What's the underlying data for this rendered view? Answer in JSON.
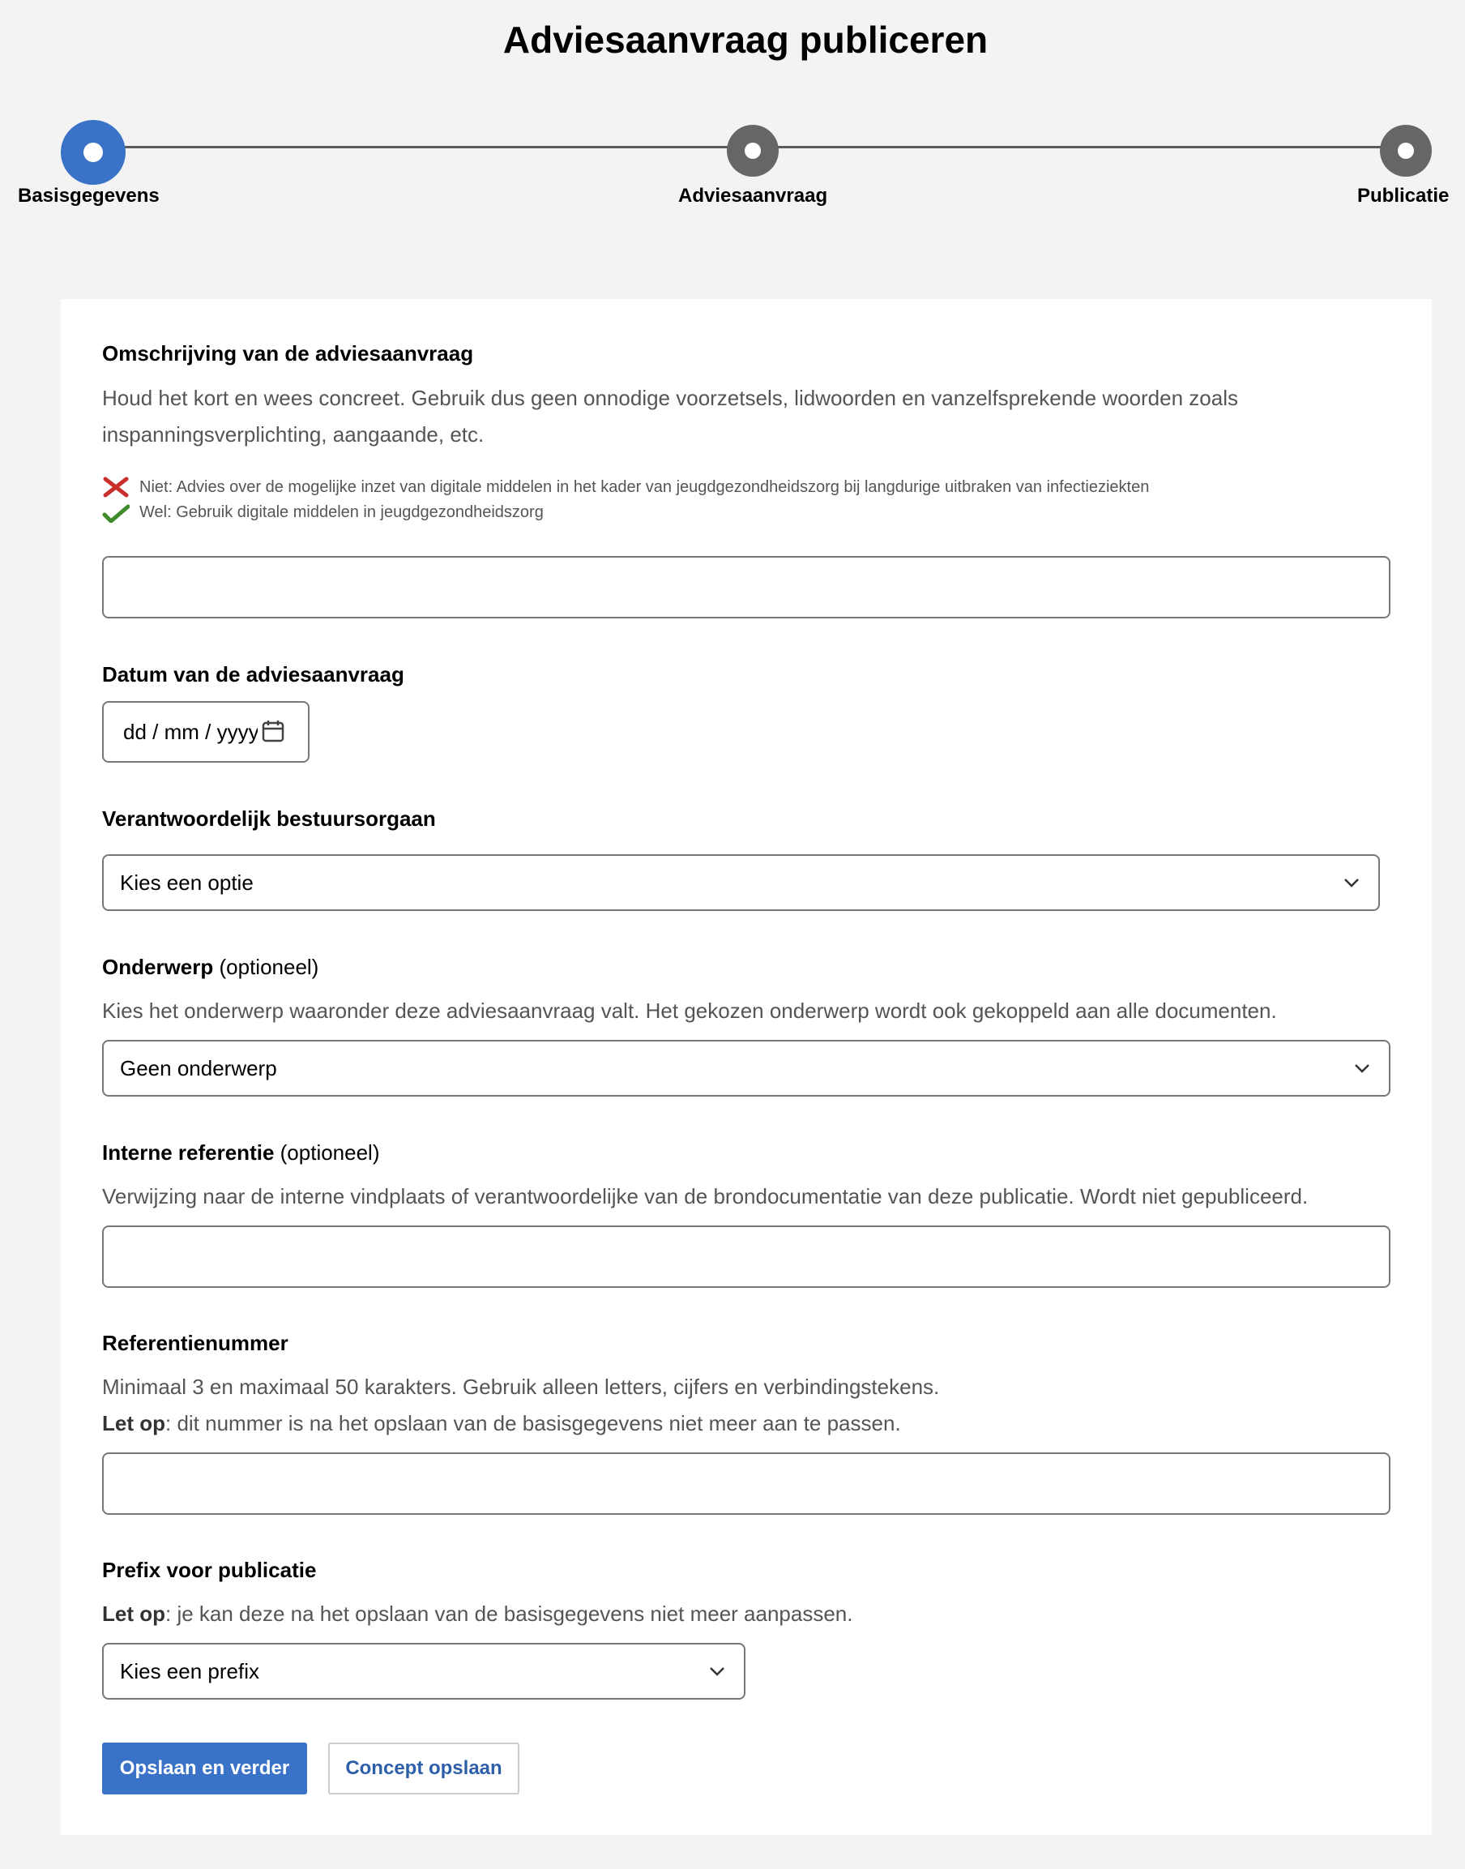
{
  "page": {
    "title": "Adviesaanvraag publiceren"
  },
  "stepper": {
    "steps": [
      {
        "label": "Basisgegevens",
        "active": true
      },
      {
        "label": "Adviesaanvraag",
        "active": false
      },
      {
        "label": "Publicatie",
        "active": false
      }
    ],
    "colors": {
      "active": "#3a72c7",
      "inactive": "#666666"
    }
  },
  "form": {
    "omschrijving": {
      "label": "Omschrijving van de adviesaanvraag",
      "help_line1": "Houd het kort en wees concreet. Gebruik dus geen onnodige voorzetsels, lidwoorden en vanzelfsprekende woorden zoals",
      "help_line2": "inspanningsverplichting, aangaande, etc.",
      "example_bad": "Niet: Advies over de mogelijke inzet van digitale middelen in het kader van jeugdgezondheidszorg bij langdurige uitbraken van infectieziekten",
      "example_good": "Wel: Gebruik digitale middelen in jeugdgezondheidszorg",
      "value": ""
    },
    "datum": {
      "label": "Datum van de adviesaanvraag",
      "placeholder": "dd / mm / yyyy"
    },
    "bestuursorgaan": {
      "label": "Verantwoordelijk bestuursorgaan",
      "selected": "Kies een optie"
    },
    "onderwerp": {
      "label": "Onderwerp",
      "optional": "(optioneel)",
      "help": "Kies het onderwerp waaronder deze adviesaanvraag valt. Het gekozen onderwerp wordt ook gekoppeld aan alle documenten.",
      "selected": "Geen onderwerp"
    },
    "interne_referentie": {
      "label": "Interne referentie",
      "optional": "(optioneel)",
      "help": "Verwijzing naar de interne vindplaats of verantwoordelijke van de brondocumentatie van deze publicatie. Wordt niet gepubliceerd.",
      "value": ""
    },
    "referentienummer": {
      "label": "Referentienummer",
      "help": "Minimaal 3 en maximaal 50 karakters. Gebruik alleen letters, cijfers en verbindingstekens.",
      "note_strong": "Let op",
      "note_rest": ": dit nummer is na het opslaan van de basisgegevens niet meer aan te passen.",
      "value": ""
    },
    "prefix": {
      "label": "Prefix voor publicatie",
      "note_strong": "Let op",
      "note_rest": ": je kan deze na het opslaan van de basisgegevens niet meer aanpassen.",
      "selected": "Kies een prefix"
    }
  },
  "actions": {
    "primary_label": "Opslaan en verder",
    "secondary_label": "Concept opslaan"
  },
  "icons": {
    "bad": "red-cross-icon",
    "good": "green-check-icon",
    "calendar": "calendar-icon",
    "chevron": "chevron-down-icon"
  }
}
